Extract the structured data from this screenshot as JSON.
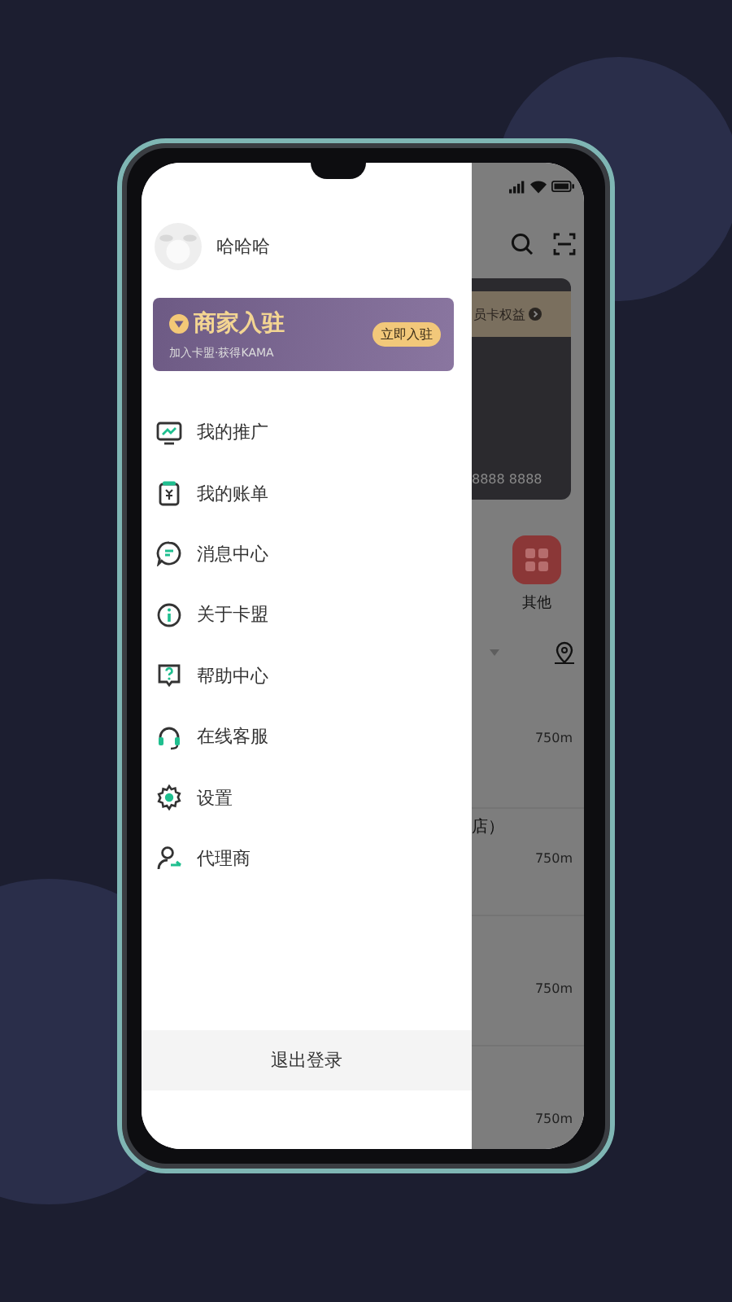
{
  "user": {
    "name": "哈哈哈"
  },
  "banner": {
    "title": "商家入驻",
    "subtitle": "加入卡盟·获得KAMA",
    "button": "立即入驻"
  },
  "menu": [
    {
      "label": "我的推广",
      "kind": "promo"
    },
    {
      "label": "我的账单",
      "kind": "bill"
    },
    {
      "label": "消息中心",
      "kind": "message"
    },
    {
      "label": "关于卡盟",
      "kind": "about"
    },
    {
      "label": "帮助中心",
      "kind": "help"
    },
    {
      "label": "在线客服",
      "kind": "service"
    },
    {
      "label": "设置",
      "kind": "settings"
    },
    {
      "label": "代理商",
      "kind": "agent"
    }
  ],
  "logout": "退出登录",
  "background_screen": {
    "card_link": "员卡权益",
    "card_number": "8888 8888",
    "shortcut": "其他",
    "store_name_end": "店）",
    "distances": [
      "750m",
      "750m",
      "750m",
      "750m"
    ]
  }
}
